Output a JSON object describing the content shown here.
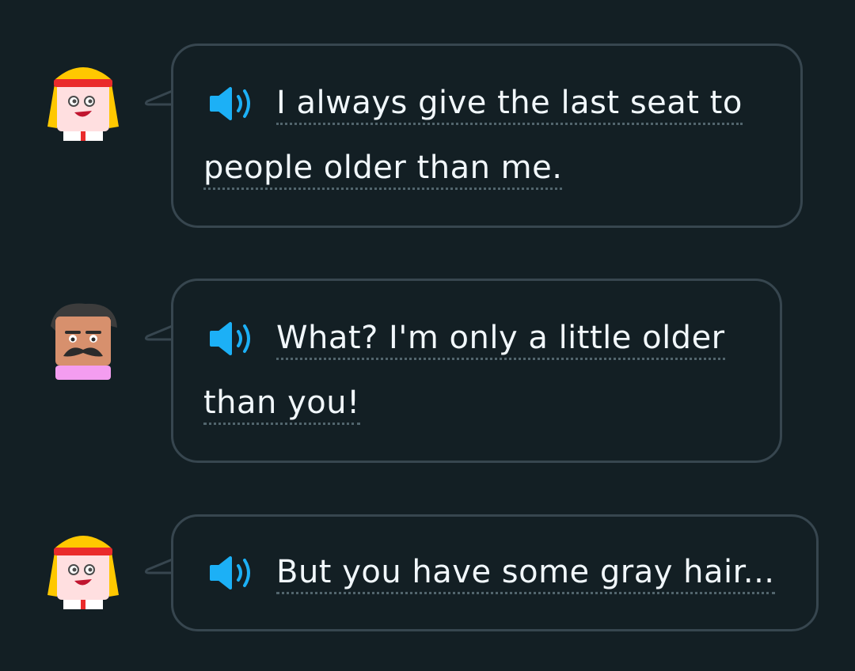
{
  "messages": [
    {
      "speaker": "woman",
      "line1": "I always give the last seat to",
      "line2": "people older than me."
    },
    {
      "speaker": "man",
      "line1": "What? I'm only a little older",
      "line2": "than you!"
    },
    {
      "speaker": "woman",
      "line1": "But you have some gray hair...",
      "line2": ""
    }
  ],
  "icons": {
    "speaker": "speaker-icon"
  },
  "colors": {
    "background": "#131f24",
    "bubble_border": "#37464f",
    "speaker_blue": "#1cb0f6",
    "text": "#f1f7fb"
  }
}
